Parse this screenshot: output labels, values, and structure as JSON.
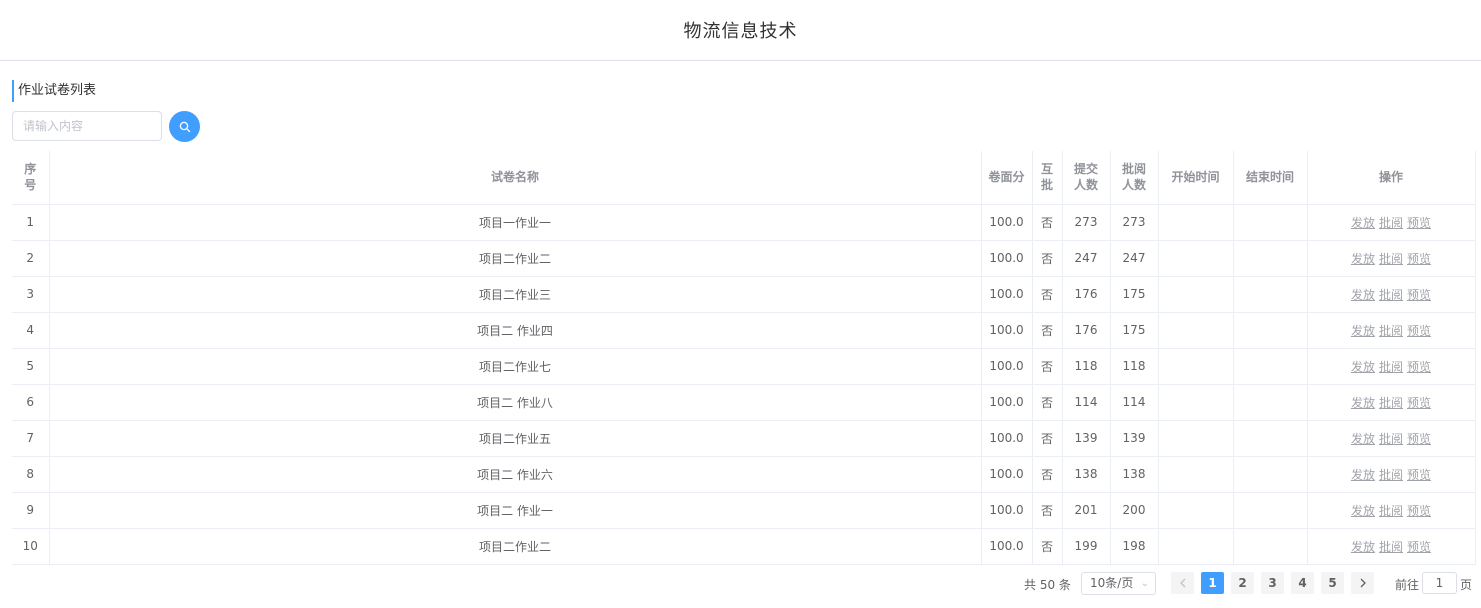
{
  "header": {
    "title": "物流信息技术"
  },
  "section": {
    "title": "作业试卷列表"
  },
  "search": {
    "placeholder": "请输入内容",
    "value": ""
  },
  "table": {
    "columns": [
      "序号",
      "试卷名称",
      "卷面分",
      "互批",
      "提交人数",
      "批阅人数",
      "开始时间",
      "结束时间",
      "操作"
    ],
    "header_display": [
      "序\n号",
      "试卷名称",
      "卷面分",
      "互\n批",
      "提交\n人数",
      "批阅\n人数",
      "开始时间",
      "结束时间",
      "操作"
    ],
    "actions": [
      "发放",
      "批阅",
      "预览"
    ],
    "rows": [
      {
        "index": "1",
        "name": "项目一作业一",
        "score": "100.0",
        "peer": "否",
        "submitted": "273",
        "reviewed": "273",
        "start": "",
        "end": ""
      },
      {
        "index": "2",
        "name": "项目二作业二",
        "score": "100.0",
        "peer": "否",
        "submitted": "247",
        "reviewed": "247",
        "start": "",
        "end": ""
      },
      {
        "index": "3",
        "name": "项目二作业三",
        "score": "100.0",
        "peer": "否",
        "submitted": "176",
        "reviewed": "175",
        "start": "",
        "end": ""
      },
      {
        "index": "4",
        "name": "项目二 作业四",
        "score": "100.0",
        "peer": "否",
        "submitted": "176",
        "reviewed": "175",
        "start": "",
        "end": ""
      },
      {
        "index": "5",
        "name": "项目二作业七",
        "score": "100.0",
        "peer": "否",
        "submitted": "118",
        "reviewed": "118",
        "start": "",
        "end": ""
      },
      {
        "index": "6",
        "name": "项目二 作业八",
        "score": "100.0",
        "peer": "否",
        "submitted": "114",
        "reviewed": "114",
        "start": "",
        "end": ""
      },
      {
        "index": "7",
        "name": "项目二作业五",
        "score": "100.0",
        "peer": "否",
        "submitted": "139",
        "reviewed": "139",
        "start": "",
        "end": ""
      },
      {
        "index": "8",
        "name": "项目二 作业六",
        "score": "100.0",
        "peer": "否",
        "submitted": "138",
        "reviewed": "138",
        "start": "",
        "end": ""
      },
      {
        "index": "9",
        "name": "项目二 作业一",
        "score": "100.0",
        "peer": "否",
        "submitted": "201",
        "reviewed": "200",
        "start": "",
        "end": ""
      },
      {
        "index": "10",
        "name": "项目二作业二",
        "score": "100.0",
        "peer": "否",
        "submitted": "199",
        "reviewed": "198",
        "start": "",
        "end": ""
      }
    ]
  },
  "pagination": {
    "total_text": "共 50 条",
    "page_size": "10条/页",
    "pages": [
      "1",
      "2",
      "3",
      "4",
      "5"
    ],
    "current_page": "1",
    "goto_label": "前往",
    "goto_value": "1",
    "goto_suffix": "页"
  },
  "colors": {
    "accent": "#409eff",
    "border": "#ebeef5",
    "header_text": "#909399",
    "link": "#a0a3a8"
  },
  "icons": {
    "search": "search-icon",
    "prev": "chevron-left-icon",
    "next": "chevron-right-icon",
    "dropdown": "chevron-down-icon"
  }
}
